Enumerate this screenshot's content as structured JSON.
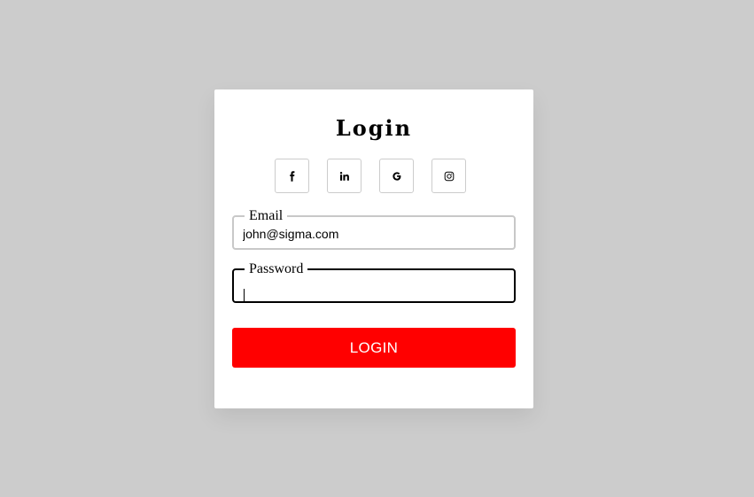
{
  "form": {
    "title": "Login",
    "social": [
      {
        "name": "facebook-icon",
        "glyph": "f"
      },
      {
        "name": "linkedin-icon",
        "glyph": "in"
      },
      {
        "name": "google-icon",
        "glyph": "G"
      },
      {
        "name": "instagram-icon",
        "glyph": "instagram"
      }
    ],
    "email": {
      "label": "Email",
      "value": "john@sigma.com"
    },
    "password": {
      "label": "Password",
      "value": ""
    },
    "submit_label": "LOGIN"
  },
  "colors": {
    "background": "#cccccc",
    "card": "#ffffff",
    "accent": "#ff0000",
    "focused_border": "#000000",
    "idle_border": "#c8c8c8"
  }
}
